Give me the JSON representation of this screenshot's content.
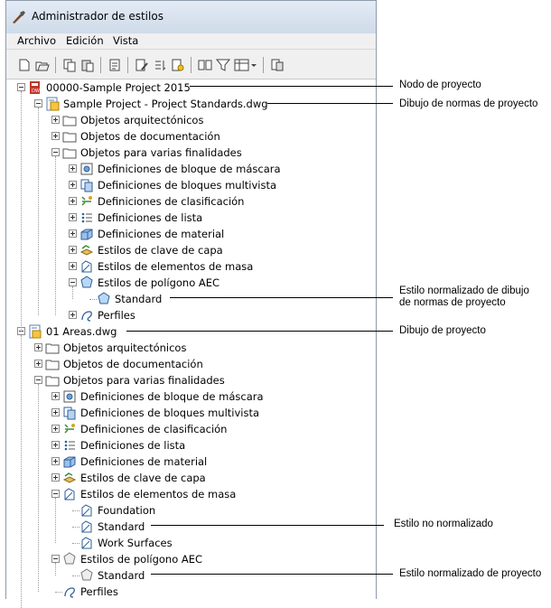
{
  "window": {
    "title": "Administrador de estilos"
  },
  "menu": [
    "Archivo",
    "Edición",
    "Vista"
  ],
  "toolbar_icons": [
    "new-icon",
    "open-icon",
    "copy-icon",
    "paste-icon",
    "purge-icon",
    "edit-icon",
    "sort-icon",
    "light-icon",
    "compare-icon",
    "filter-icon",
    "view-icon",
    "settings-icon"
  ],
  "tree": {
    "project": "00000-Sample Project 2015",
    "standards_dwg": "Sample Project - Project Standards.dwg",
    "cat_arch": "Objetos arquitectónicos",
    "cat_doc": "Objetos de documentación",
    "cat_multi": "Objetos para varias finalidades",
    "mask": "Definiciones de bloque de máscara",
    "multiview": "Definiciones de bloques multivista",
    "classif": "Definiciones de clasificación",
    "list": "Definiciones de lista",
    "material": "Definiciones de material",
    "layerkey": "Estilos de clave de capa",
    "mass": "Estilos de elementos de masa",
    "polygon": "Estilos de polígono AEC",
    "standard": "Standard",
    "profiles": "Perfiles",
    "areas_dwg": "01 Areas.dwg",
    "foundation": "Foundation",
    "work_surfaces": "Work Surfaces"
  },
  "callouts": {
    "node": "Nodo de proyecto",
    "standards_drawing": "Dibujo de normas de proyecto",
    "normalized_std": [
      "Estilo normalizado de dibujo",
      "de normas de proyecto"
    ],
    "project_drawing": "Dibujo de proyecto",
    "not_normalized": "Estilo no normalizado",
    "normalized_proj": "Estilo normalizado de proyecto"
  }
}
